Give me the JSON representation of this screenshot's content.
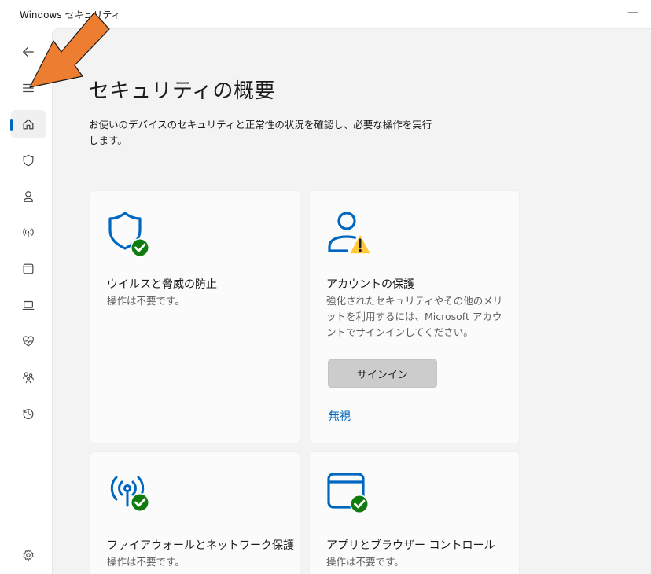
{
  "window": {
    "title": "Windows セキュリティ",
    "minimize_glyph": "—"
  },
  "sidebar": {
    "items": [
      {
        "icon": "back-arrow-icon"
      },
      {
        "icon": "hamburger-menu-icon"
      },
      {
        "icon": "home-icon",
        "active": true
      },
      {
        "icon": "shield-icon"
      },
      {
        "icon": "account-person-icon"
      },
      {
        "icon": "wireless-antenna-icon"
      },
      {
        "icon": "app-window-icon"
      },
      {
        "icon": "laptop-icon"
      },
      {
        "icon": "heart-pulse-icon"
      },
      {
        "icon": "family-icon"
      },
      {
        "icon": "history-icon"
      },
      {
        "icon": "settings-gear-icon"
      }
    ]
  },
  "main": {
    "title": "セキュリティの概要",
    "description": "お使いのデバイスのセキュリティと正常性の状況を確認し、必要な操作を実行します。"
  },
  "cards": [
    {
      "title": "ウイルスと脅威の防止",
      "status": "操作は不要です。",
      "icon": "shield-check-icon",
      "badge": "ok"
    },
    {
      "title": "アカウントの保護",
      "status": "強化されたセキュリティやその他のメリットを利用するには、Microsoft アカウントでサインインしてください。",
      "icon": "account-warning-icon",
      "badge": "warning",
      "button_label": "サインイン",
      "link_label": "無視"
    },
    {
      "title": "ファイアウォールとネットワーク保護",
      "status": "操作は不要です。",
      "icon": "antenna-check-icon",
      "badge": "ok"
    },
    {
      "title": "アプリとブラウザー コントロール",
      "status": "操作は不要です。",
      "icon": "browser-check-icon",
      "badge": "ok"
    }
  ],
  "colors": {
    "accent_blue": "#0067c0",
    "ok_green": "#107c10",
    "warning_yellow": "#ffc83d",
    "annotation_orange": "#ed7d31"
  }
}
